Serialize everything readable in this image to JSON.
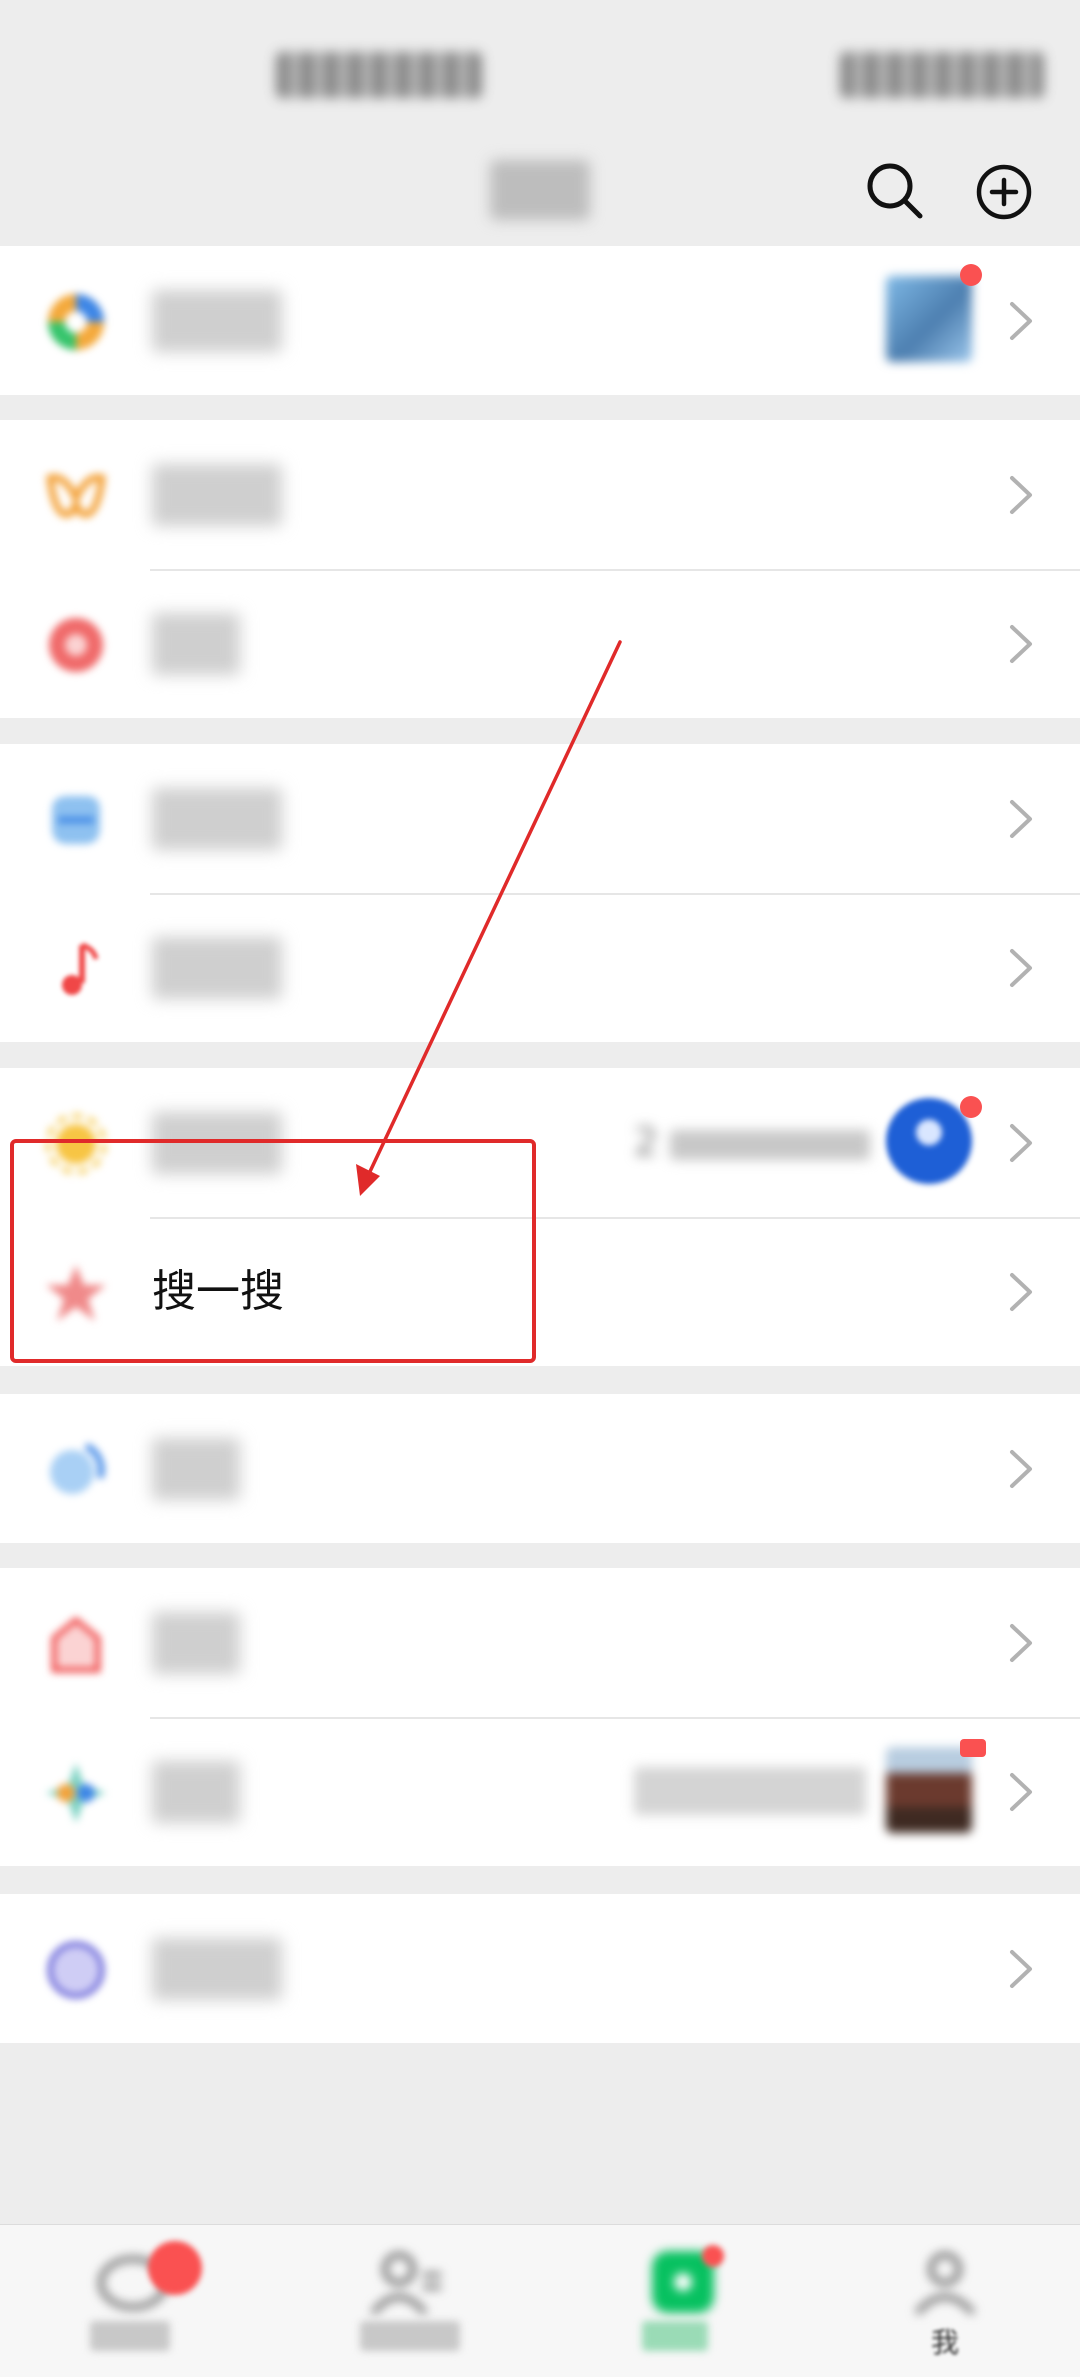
{
  "status_bar": {
    "left_text": "",
    "right_text": ""
  },
  "header": {
    "title": "",
    "search_icon": "search-icon",
    "add_icon": "plus-circle-icon"
  },
  "menu": {
    "groups": [
      {
        "rows": [
          {
            "id": "moments",
            "label": "",
            "icon": "moments-icon",
            "icon_color": "#f4a93b",
            "thumbnail": true,
            "red_dot": true
          }
        ]
      },
      {
        "rows": [
          {
            "id": "channels",
            "label": "",
            "icon": "channels-icon",
            "icon_color": "#f3a23a"
          },
          {
            "id": "live",
            "label": "",
            "icon": "live-icon",
            "icon_color": "#f06a6a"
          }
        ]
      },
      {
        "rows": [
          {
            "id": "scan",
            "label": "",
            "icon": "scan-icon",
            "icon_color": "#3d86e6"
          },
          {
            "id": "listen",
            "label": "",
            "icon": "music-note-icon",
            "icon_color": "#f04747"
          }
        ]
      },
      {
        "rows": [
          {
            "id": "top-stories",
            "label": "",
            "icon": "top-stories-icon",
            "icon_color": "#f7c544",
            "detail": "2",
            "avatar": true,
            "red_dot": true
          },
          {
            "id": "search",
            "label": "搜一搜",
            "icon": "search-star-icon",
            "icon_color": "#f06a6a"
          }
        ]
      },
      {
        "rows": [
          {
            "id": "nearby",
            "label": "",
            "icon": "nearby-icon",
            "icon_color": "#3d86e6"
          }
        ]
      },
      {
        "rows": [
          {
            "id": "shopping",
            "label": "",
            "icon": "shopping-bag-icon",
            "icon_color": "#f04747"
          },
          {
            "id": "games",
            "label": "",
            "icon": "games-icon",
            "icon_color": "#f3a23a",
            "detail": "",
            "thumbnail": true,
            "red_dot": true
          }
        ]
      },
      {
        "rows": [
          {
            "id": "mini-programs",
            "label": "",
            "icon": "mini-programs-icon",
            "icon_color": "#6a67d8"
          }
        ]
      }
    ]
  },
  "tabs": [
    {
      "id": "chats",
      "label": "",
      "icon": "chat-bubble-icon",
      "badge": true
    },
    {
      "id": "contacts",
      "label": "",
      "icon": "contacts-icon"
    },
    {
      "id": "discover",
      "label": "",
      "icon": "compass-icon",
      "active": true,
      "badge": true
    },
    {
      "id": "me",
      "label": "我",
      "icon": "person-icon"
    }
  ],
  "colors": {
    "accent_green": "#07c160",
    "badge_red": "#fa5151",
    "annotation_red": "#e02a2a",
    "background": "#ededed"
  }
}
